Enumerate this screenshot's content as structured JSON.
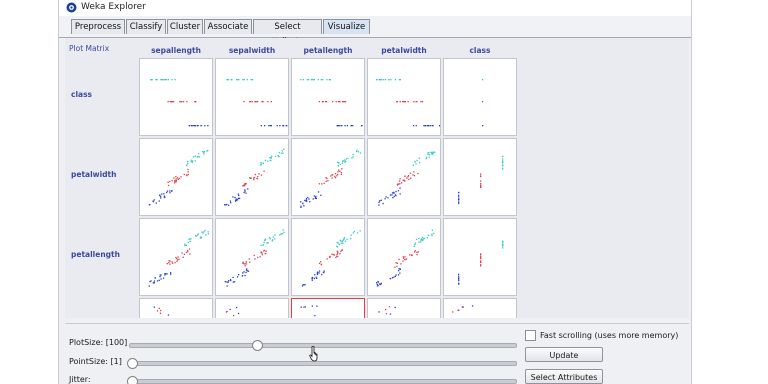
{
  "window": {
    "title": "Weka Explorer",
    "icon": "weka-bird-icon"
  },
  "tabs": [
    {
      "label": "Preprocess",
      "active": false
    },
    {
      "label": "Classify",
      "active": false
    },
    {
      "label": "Cluster",
      "active": false
    },
    {
      "label": "Associate",
      "active": false
    },
    {
      "label": "Select attributes",
      "active": false
    },
    {
      "label": "Visualize",
      "active": true
    }
  ],
  "matrix": {
    "label": "Plot Matrix",
    "columns": [
      "sepallength",
      "sepalwidth",
      "petallength",
      "petalwidth",
      "class"
    ],
    "rows": [
      "class",
      "petalwidth",
      "petallength"
    ],
    "selected_cell": "petallength-x-partial-row",
    "class_colors": [
      "#2b3fcf",
      "#e0404a",
      "#36c9c4"
    ]
  },
  "controls": {
    "plot_size": {
      "label": "PlotSize: [100]",
      "value": 100,
      "fraction": 0.44
    },
    "point_size": {
      "label": "PointSize: [1]",
      "value": 1,
      "fraction": 0.0
    },
    "jitter": {
      "label": "Jitter:",
      "value": 0,
      "fraction": 0.0
    },
    "fast_scrolling": {
      "label": "Fast scrolling (uses more memory)",
      "checked": false
    },
    "update_label": "Update",
    "select_attributes_label": "Select Attributes",
    "scroll_arrows": "▲ ▼"
  }
}
